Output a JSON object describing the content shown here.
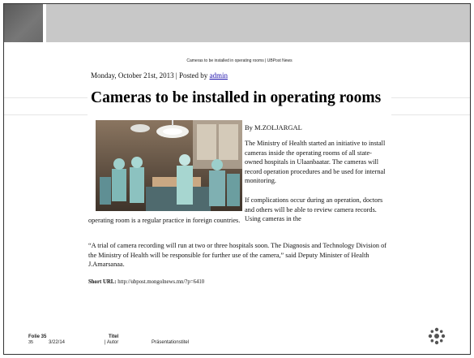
{
  "article": {
    "page_header": "Cameras to be installed in operating rooms | UBPost News",
    "date_text": "Monday, October 21st, 2013 | Posted by ",
    "author_link": "admin",
    "headline": "Cameras to be installed in operating rooms",
    "byline": "By M.ZOLJARGAL",
    "paragraph1": "The Ministry of Health started an initiative to install cameras inside the operating rooms of all state-owned hospitals in Ulaanbaatar. The cameras will record operation procedures and be used for internal monitoring.",
    "paragraph2a": "If complications occur during an operation, doctors and others will be able to review camera records. Using cameras in the",
    "paragraph2b": "operating room is a regular practice in foreign countries.",
    "paragraph3": "“A trial of camera recording will run at two or three hospitals soon. The Diagnosis and Technology Division of the Ministry of Health will be responsible for further use of the camera,” said Deputy Minister of Health J.Amarsanaa.",
    "short_url_label": "Short URL:",
    "short_url": "http://ubpost.mongolnews.mn/?p=6410"
  },
  "footer": {
    "folie_label": "Folie 35",
    "slide_number": "35",
    "date": "3/22/14",
    "titel_label": "Titel",
    "autor": "| Autor",
    "presentation_title": "Präsentationstitel"
  },
  "colors": {
    "top_bar": "#c8c8c8",
    "corner_block": "#666666",
    "link": "#1a0dab",
    "logo": "#555555"
  },
  "icons": {
    "logo": "university-seal-icon",
    "photo": "surgery-photo"
  }
}
